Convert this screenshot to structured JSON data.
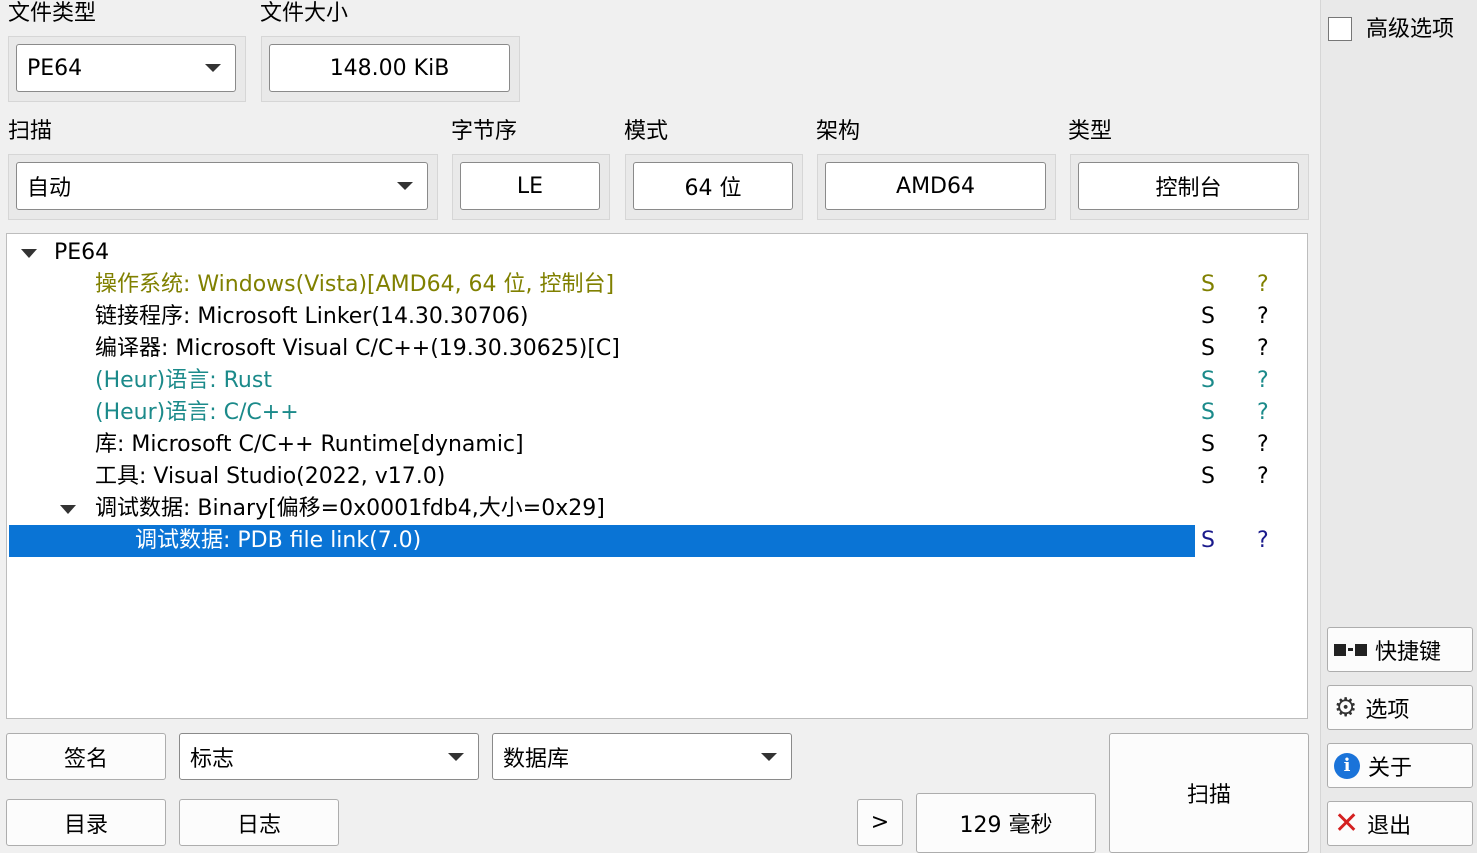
{
  "file_type": {
    "label": "文件类型",
    "value": "PE64"
  },
  "file_size": {
    "label": "文件大小",
    "value": "148.00 KiB"
  },
  "scan": {
    "label": "扫描",
    "value": "自动"
  },
  "endianness": {
    "label": "字节序",
    "value": "LE"
  },
  "mode": {
    "label": "模式",
    "value": "64 位"
  },
  "architecture": {
    "label": "架构",
    "value": "AMD64"
  },
  "type": {
    "label": "类型",
    "value": "控制台"
  },
  "tree": {
    "root": "PE64",
    "rows": [
      {
        "text": "操作系统: Windows(Vista)[AMD64, 64 位, 控制台]",
        "s": "S",
        "q": "?",
        "color": "#808000"
      },
      {
        "text": "链接程序: Microsoft Linker(14.30.30706)",
        "s": "S",
        "q": "?",
        "color": "#000000"
      },
      {
        "text": "编译器: Microsoft Visual C/C++(19.30.30625)[C]",
        "s": "S",
        "q": "?",
        "color": "#000000"
      },
      {
        "text": "(Heur)语言: Rust",
        "s": "S",
        "q": "?",
        "color": "#1b8a8a"
      },
      {
        "text": "(Heur)语言: C/C++",
        "s": "S",
        "q": "?",
        "color": "#1b8a8a"
      },
      {
        "text": "库: Microsoft C/C++ Runtime[dynamic]",
        "s": "S",
        "q": "?",
        "color": "#000000"
      },
      {
        "text": "工具: Visual Studio(2022, v17.0)",
        "s": "S",
        "q": "?",
        "color": "#000000"
      },
      {
        "text": "调试数据: Binary[偏移=0x0001fdb4,大小=0x29]",
        "s": "",
        "q": "",
        "color": "#000000"
      },
      {
        "text": "调试数据: PDB file link(7.0)",
        "s": "S",
        "q": "?",
        "color": "#ffffff",
        "selected": true
      }
    ]
  },
  "bottom": {
    "signature_button": "签名",
    "flags_combo": "标志",
    "database_combo": "数据库",
    "directory_button": "目录",
    "log_button": "日志",
    "more_button": ">",
    "time_display": "129 毫秒",
    "scan_button": "扫描"
  },
  "side": {
    "advanced_label": "高级选项",
    "advanced_checked": false,
    "shortcuts_button": "快捷键",
    "options_button": "选项",
    "about_button": "关于",
    "exit_button": "退出"
  },
  "colors": {
    "selection": "#0a74d5",
    "olive_text": "#808000",
    "teal_text": "#1b8a8a",
    "exit_icon": "#d42020",
    "info_icon": "#1a73d9"
  }
}
